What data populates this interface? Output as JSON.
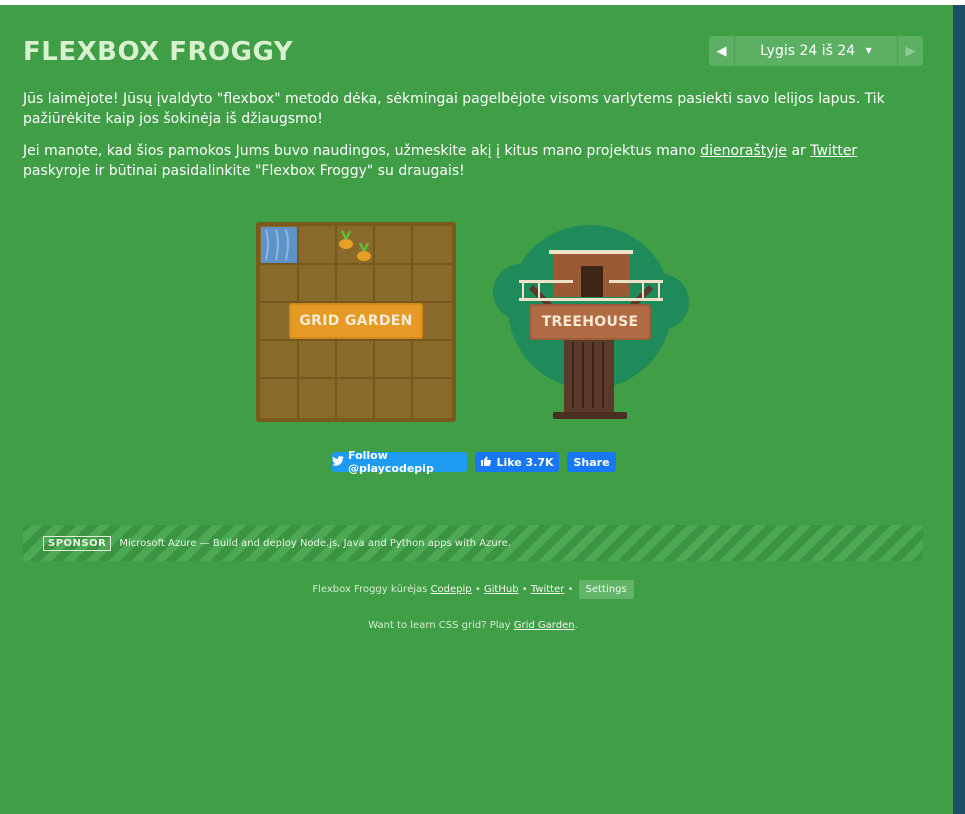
{
  "app": {
    "logo": "FLEXBOX FROGGY"
  },
  "level_nav": {
    "label": "Lygis 24 iš 24",
    "prev_icon": "triangle-left-icon",
    "next_icon": "triangle-right-icon"
  },
  "message": {
    "p1": "Jūs laimėjote! Jūsų įvaldyto \"flexbox\" metodo dėka, sėkmingai pagelbėjote visoms varlytems pasiekti savo lelijos lapus. Tik pažiūrėkite kaip jos šokinėja iš džiaugsmo!",
    "p2_a": "Jei manote, kad šios pamokos Jums buvo naudingos, užmeskite akį į kitus mano projektus mano ",
    "p2_link1": "dienoraštyje",
    "p2_b": " ar ",
    "p2_link2": "Twitter",
    "p2_c": " paskyroje ir būtinai pasidalinkite \"Flexbox Froggy\" su draugais!"
  },
  "games": {
    "garden_label": "GRID GARDEN",
    "tree_label": "TREEHOUSE"
  },
  "social": {
    "twitter_label": "Follow @playcodepip",
    "like_label": "Like",
    "like_count": "3.7K",
    "share_label": "Share"
  },
  "sponsor": {
    "badge": "SPONSOR",
    "text": "Microsoft Azure — Build and deploy Node.js, Java and Python apps with Azure."
  },
  "footer": {
    "prefix": "Flexbox Froggy kūrėjas ",
    "codepip": "Codepip",
    "github": "GitHub",
    "twitter": "Twitter",
    "sep": " • ",
    "settings": "Settings",
    "line2_prefix": "Want to learn CSS grid? Play ",
    "line2_link": "Grid Garden",
    "line2_suffix": "."
  },
  "colors": {
    "background": "#3f9e46",
    "logo": "#d8f1cf",
    "garden_button": "#e49a25",
    "tree_button": "#b06a44",
    "twitter": "#1d9bf0",
    "facebook": "#1877f2"
  }
}
